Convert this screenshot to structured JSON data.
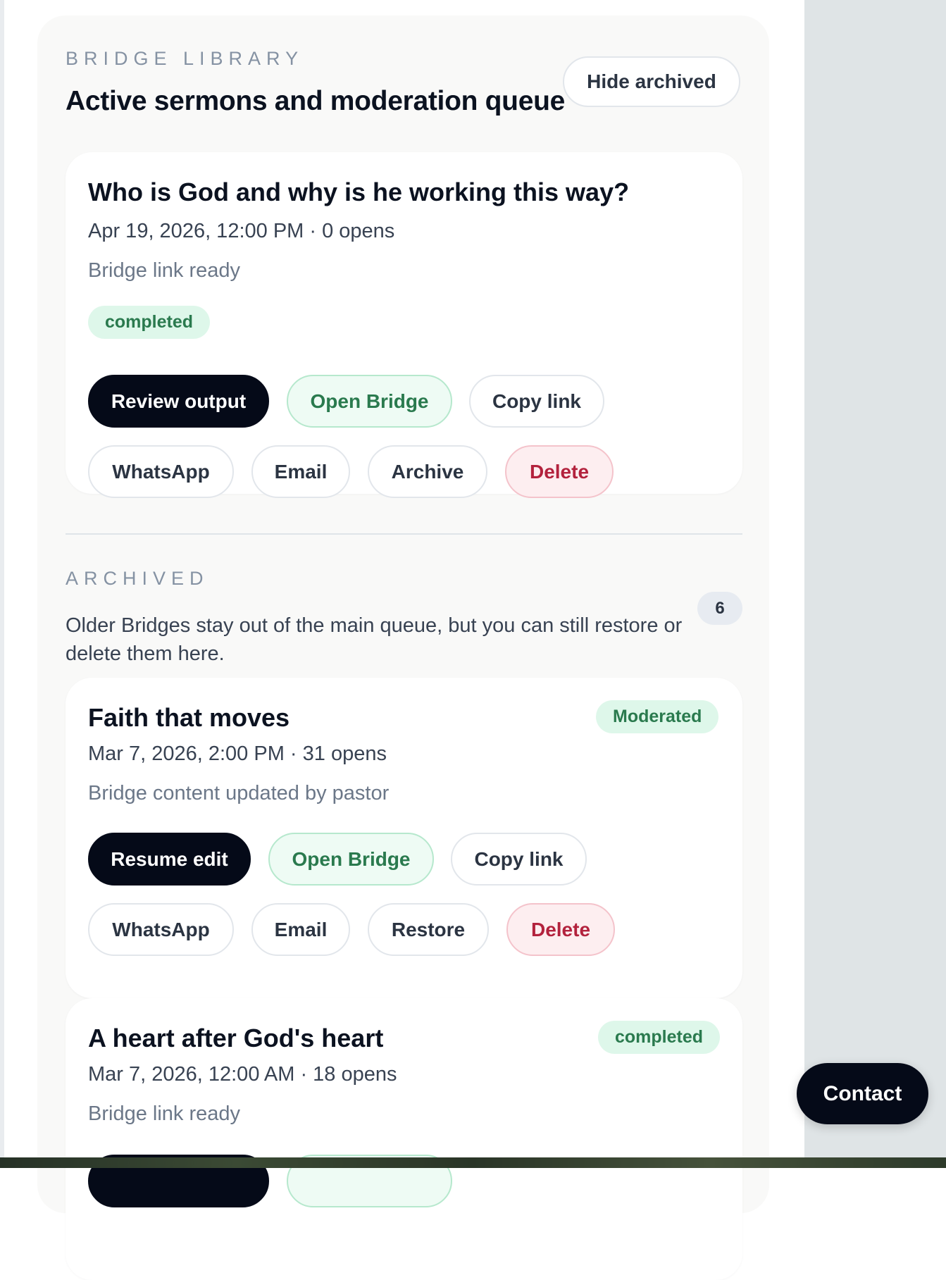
{
  "library": {
    "eyebrow": "BRIDGE LIBRARY",
    "title": "Active sermons and moderation queue",
    "hide_archived_label": "Hide archived"
  },
  "active_cards": [
    {
      "title": "Who is God and why is he working this way?",
      "meta": "Apr 19, 2026, 12:00 PM · 0 opens",
      "status_text": "Bridge link ready",
      "badge": "completed",
      "primary_action": "Review output",
      "open_bridge": "Open Bridge",
      "copy_link": "Copy link",
      "whatsapp": "WhatsApp",
      "email": "Email",
      "secondary_action": "Archive",
      "delete": "Delete"
    }
  ],
  "archived": {
    "eyebrow": "ARCHIVED",
    "description": "Older Bridges stay out of the main queue, but you can still restore or delete them here.",
    "count": "6",
    "cards": [
      {
        "title": "Faith that moves",
        "meta": "Mar 7, 2026, 2:00 PM · 31 opens",
        "status_text": "Bridge content updated by pastor",
        "badge": "Moderated",
        "primary_action": "Resume edit",
        "open_bridge": "Open Bridge",
        "copy_link": "Copy link",
        "whatsapp": "WhatsApp",
        "email": "Email",
        "secondary_action": "Restore",
        "delete": "Delete"
      },
      {
        "title": "A heart after God's heart",
        "meta": "Mar 7, 2026, 12:00 AM · 18 opens",
        "status_text": "Bridge link ready",
        "badge": "completed"
      }
    ]
  },
  "contact_label": "Contact",
  "colors": {
    "primary": "#050a18",
    "success_bg": "#def7ea",
    "success_text": "#2a7a4e",
    "danger_bg": "#fdeef0",
    "danger_text": "#b3223d"
  }
}
